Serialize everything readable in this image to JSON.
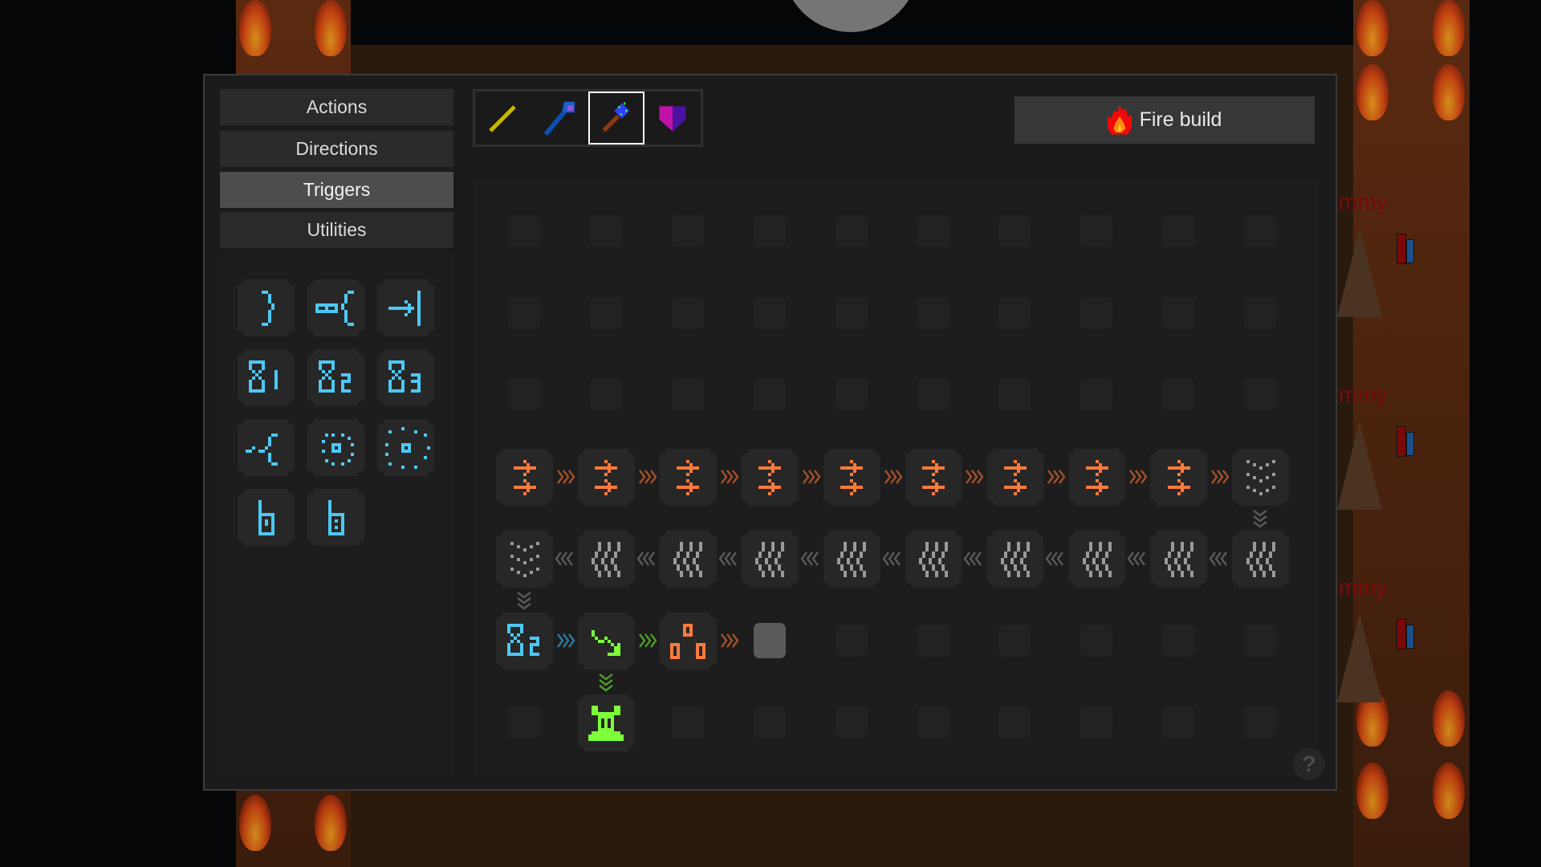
{
  "categories": [
    {
      "label": "Actions",
      "selected": false
    },
    {
      "label": "Directions",
      "selected": false
    },
    {
      "label": "Triggers",
      "selected": true
    },
    {
      "label": "Utilities",
      "selected": false
    }
  ],
  "wands": [
    {
      "icon": "yellow-wand-icon",
      "selected": false
    },
    {
      "icon": "blue-staff-icon",
      "selected": false
    },
    {
      "icon": "green-gem-staff-icon",
      "selected": true
    },
    {
      "icon": "purple-shield-icon",
      "selected": false
    }
  ],
  "fire_button": {
    "label": "Fire build",
    "icon": "flame-icon"
  },
  "palette": [
    "bracket-close-icon",
    "infinity-bracket-icon",
    "arrow-to-bar-icon",
    "hourglass-1-icon",
    "hourglass-2-icon",
    "hourglass-3-icon",
    "branch-bracket-icon",
    "dotted-circle-small-icon",
    "dotted-circle-large-icon",
    "timer-b-icon",
    "timer-b-dot-icon"
  ],
  "grid": {
    "columns": 10,
    "rows": [
      [
        null,
        null,
        null,
        null,
        null,
        null,
        null,
        null,
        null,
        null
      ],
      [
        null,
        null,
        null,
        null,
        null,
        null,
        null,
        null,
        null,
        null
      ],
      [
        null,
        null,
        null,
        null,
        null,
        null,
        null,
        null,
        null,
        null
      ],
      [
        "double-arrow-icon",
        "double-arrow-icon",
        "double-arrow-icon",
        "double-arrow-icon",
        "double-arrow-icon",
        "double-arrow-icon",
        "double-arrow-icon",
        "double-arrow-icon",
        "double-arrow-icon",
        "chevrons-down-icon"
      ],
      [
        "chevrons-down-icon",
        "wavy-lines-icon",
        "wavy-lines-icon",
        "wavy-lines-icon",
        "wavy-lines-icon",
        "wavy-lines-icon",
        "wavy-lines-icon",
        "wavy-lines-icon",
        "wavy-lines-icon",
        "wavy-lines-icon"
      ],
      [
        "hourglass-2-icon",
        "squiggle-arrow-icon",
        "three-circles-icon",
        "placeholder-block",
        null,
        null,
        null,
        null,
        null,
        null
      ],
      [
        null,
        "green-totem-icon",
        null,
        null,
        null,
        null,
        null,
        null,
        null,
        null
      ]
    ],
    "connectors": [
      {
        "from": [
          3,
          0
        ],
        "to": [
          3,
          1
        ],
        "dir": "right",
        "color": "#a4502a"
      },
      {
        "from": [
          3,
          1
        ],
        "to": [
          3,
          2
        ],
        "dir": "right",
        "color": "#a4502a"
      },
      {
        "from": [
          3,
          2
        ],
        "to": [
          3,
          3
        ],
        "dir": "right",
        "color": "#a4502a"
      },
      {
        "from": [
          3,
          3
        ],
        "to": [
          3,
          4
        ],
        "dir": "right",
        "color": "#a4502a"
      },
      {
        "from": [
          3,
          4
        ],
        "to": [
          3,
          5
        ],
        "dir": "right",
        "color": "#a4502a"
      },
      {
        "from": [
          3,
          5
        ],
        "to": [
          3,
          6
        ],
        "dir": "right",
        "color": "#a4502a"
      },
      {
        "from": [
          3,
          6
        ],
        "to": [
          3,
          7
        ],
        "dir": "right",
        "color": "#a4502a"
      },
      {
        "from": [
          3,
          7
        ],
        "to": [
          3,
          8
        ],
        "dir": "right",
        "color": "#a4502a"
      },
      {
        "from": [
          3,
          8
        ],
        "to": [
          3,
          9
        ],
        "dir": "right",
        "color": "#a4502a"
      },
      {
        "from": [
          3,
          9
        ],
        "to": [
          4,
          9
        ],
        "dir": "down",
        "color": "#5a5a5a"
      },
      {
        "from": [
          4,
          9
        ],
        "to": [
          4,
          8
        ],
        "dir": "left",
        "color": "#5a5a5a"
      },
      {
        "from": [
          4,
          8
        ],
        "to": [
          4,
          7
        ],
        "dir": "left",
        "color": "#5a5a5a"
      },
      {
        "from": [
          4,
          7
        ],
        "to": [
          4,
          6
        ],
        "dir": "left",
        "color": "#5a5a5a"
      },
      {
        "from": [
          4,
          6
        ],
        "to": [
          4,
          5
        ],
        "dir": "left",
        "color": "#5a5a5a"
      },
      {
        "from": [
          4,
          5
        ],
        "to": [
          4,
          4
        ],
        "dir": "left",
        "color": "#5a5a5a"
      },
      {
        "from": [
          4,
          4
        ],
        "to": [
          4,
          3
        ],
        "dir": "left",
        "color": "#5a5a5a"
      },
      {
        "from": [
          4,
          3
        ],
        "to": [
          4,
          2
        ],
        "dir": "left",
        "color": "#5a5a5a"
      },
      {
        "from": [
          4,
          2
        ],
        "to": [
          4,
          1
        ],
        "dir": "left",
        "color": "#5a5a5a"
      },
      {
        "from": [
          4,
          1
        ],
        "to": [
          4,
          0
        ],
        "dir": "left",
        "color": "#5a5a5a"
      },
      {
        "from": [
          4,
          0
        ],
        "to": [
          5,
          0
        ],
        "dir": "down",
        "color": "#5a5a5a"
      },
      {
        "from": [
          5,
          0
        ],
        "to": [
          5,
          1
        ],
        "dir": "right",
        "color": "#2f7aa0"
      },
      {
        "from": [
          5,
          1
        ],
        "to": [
          5,
          2
        ],
        "dir": "right",
        "color": "#4e9a2a"
      },
      {
        "from": [
          5,
          2
        ],
        "to": [
          5,
          3
        ],
        "dir": "right",
        "color": "#a4502a"
      },
      {
        "from": [
          5,
          1
        ],
        "to": [
          6,
          1
        ],
        "dir": "down",
        "color": "#4e9a2a"
      }
    ]
  },
  "help_button": {
    "label": "?"
  },
  "scene": {
    "enemy_labels": [
      "mmy",
      "mmy",
      "mmy"
    ]
  },
  "colors": {
    "cyan": "#4cc8f4",
    "orange": "#ff7a3d",
    "green": "#7dff3a",
    "gray": "#9a9a9a"
  }
}
